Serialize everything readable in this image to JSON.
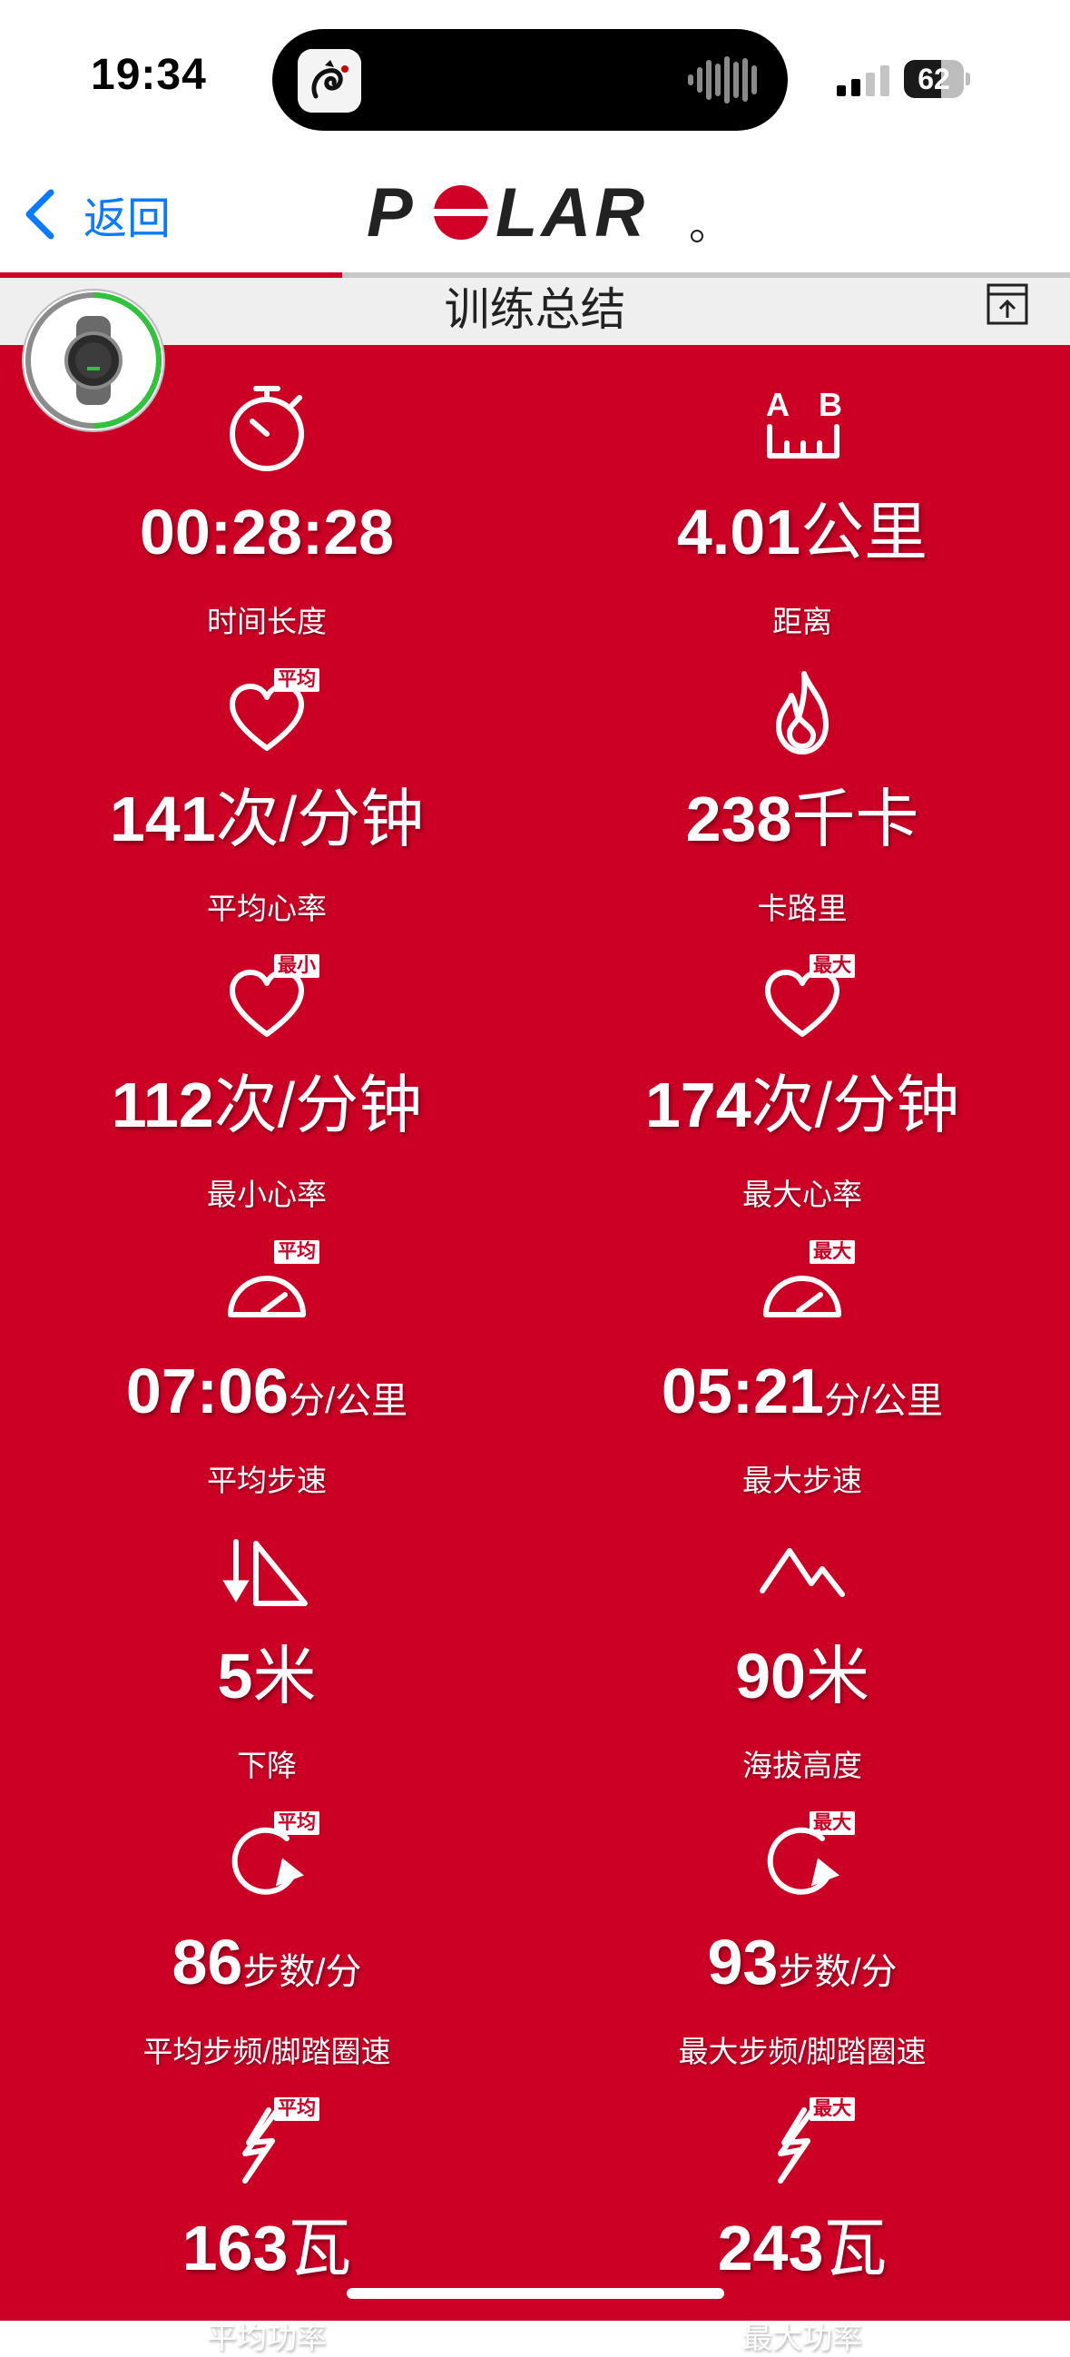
{
  "status_bar": {
    "time": "19:34",
    "battery": "62",
    "battery_level": 0.62
  },
  "nav": {
    "back_label": "返回",
    "logo_text": "POLAR"
  },
  "toolbar": {
    "title": "训练总结",
    "progress_fraction": 0.32
  },
  "colors": {
    "brand_red": "#cc0025",
    "link_blue": "#0a7aff"
  },
  "stats": [
    {
      "icon": "stopwatch-icon",
      "tag": "",
      "value": "00:28:28",
      "unit": "",
      "label": "时间长度"
    },
    {
      "icon": "distance-icon",
      "tag": "",
      "value": "4.01",
      "unit": "公里",
      "label": "距离",
      "marker_a": "A",
      "marker_b": "B"
    },
    {
      "icon": "heart-icon",
      "tag": "平均",
      "value": "141",
      "unit": "次/分钟",
      "label": "平均心率"
    },
    {
      "icon": "flame-icon",
      "tag": "",
      "value": "238",
      "unit": "千卡",
      "label": "卡路里"
    },
    {
      "icon": "heart-icon",
      "tag": "最小",
      "value": "112",
      "unit": "次/分钟",
      "label": "最小心率"
    },
    {
      "icon": "heart-icon",
      "tag": "最大",
      "value": "174",
      "unit": "次/分钟",
      "label": "最大心率"
    },
    {
      "icon": "speedometer-icon",
      "tag": "平均",
      "value": "07:06",
      "unit": "分/公里",
      "label": "平均步速"
    },
    {
      "icon": "speedometer-icon",
      "tag": "最大",
      "value": "05:21",
      "unit": "分/公里",
      "label": "最大步速"
    },
    {
      "icon": "descent-icon",
      "tag": "",
      "value": "5",
      "unit": "米",
      "label": "下降"
    },
    {
      "icon": "mountain-icon",
      "tag": "",
      "value": "90",
      "unit": "米",
      "label": "海拔高度"
    },
    {
      "icon": "cadence-icon",
      "tag": "平均",
      "value": "86",
      "unit": "步数/分",
      "label": "平均步频/脚踏圈速"
    },
    {
      "icon": "cadence-icon",
      "tag": "最大",
      "value": "93",
      "unit": "步数/分",
      "label": "最大步频/脚踏圈速"
    },
    {
      "icon": "power-icon",
      "tag": "平均",
      "value": "163",
      "unit": "瓦",
      "label": "平均功率"
    },
    {
      "icon": "power-icon",
      "tag": "最大",
      "value": "243",
      "unit": "瓦",
      "label": "最大功率"
    }
  ]
}
